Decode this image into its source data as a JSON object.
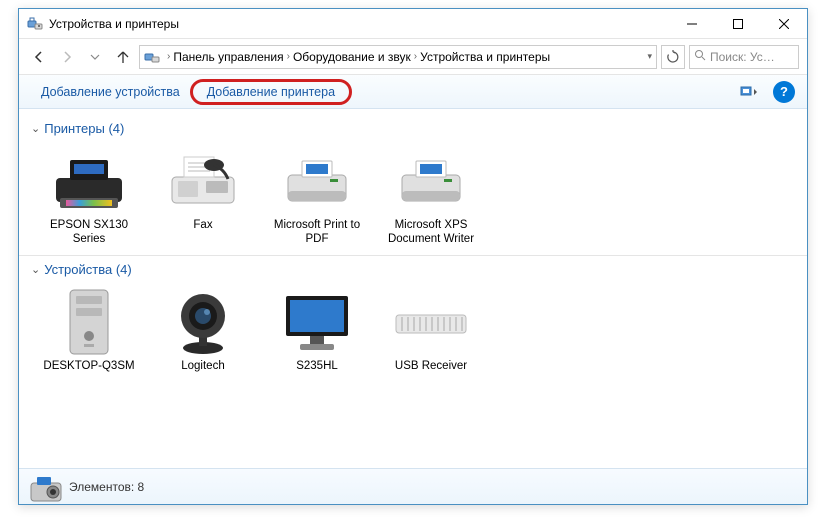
{
  "window": {
    "title": "Устройства и принтеры"
  },
  "breadcrumb": {
    "items": [
      "Панель управления",
      "Оборудование и звук",
      "Устройства и принтеры"
    ]
  },
  "nav": {
    "refresh": "↻"
  },
  "search": {
    "placeholder": "Поиск: Ус…"
  },
  "toolbar": {
    "add_device_label": "Добавление устройства",
    "add_printer_label": "Добавление принтера",
    "help_label": "?"
  },
  "groups": [
    {
      "title": "Принтеры (4)",
      "items": [
        {
          "label": "EPSON SX130 Series",
          "icon": "inkjet-printer"
        },
        {
          "label": "Fax",
          "icon": "fax"
        },
        {
          "label": "Microsoft Print to PDF",
          "icon": "laser-printer"
        },
        {
          "label": "Microsoft XPS Document Writer",
          "icon": "laser-printer"
        }
      ]
    },
    {
      "title": "Устройства (4)",
      "items": [
        {
          "label": "DESKTOP-Q3SM",
          "icon": "pc-tower"
        },
        {
          "label": "Logitech",
          "icon": "webcam"
        },
        {
          "label": "S235HL",
          "icon": "monitor"
        },
        {
          "label": "USB Receiver",
          "icon": "usb-receiver"
        }
      ]
    }
  ],
  "statusbar": {
    "count_label": "Элементов: 8"
  }
}
